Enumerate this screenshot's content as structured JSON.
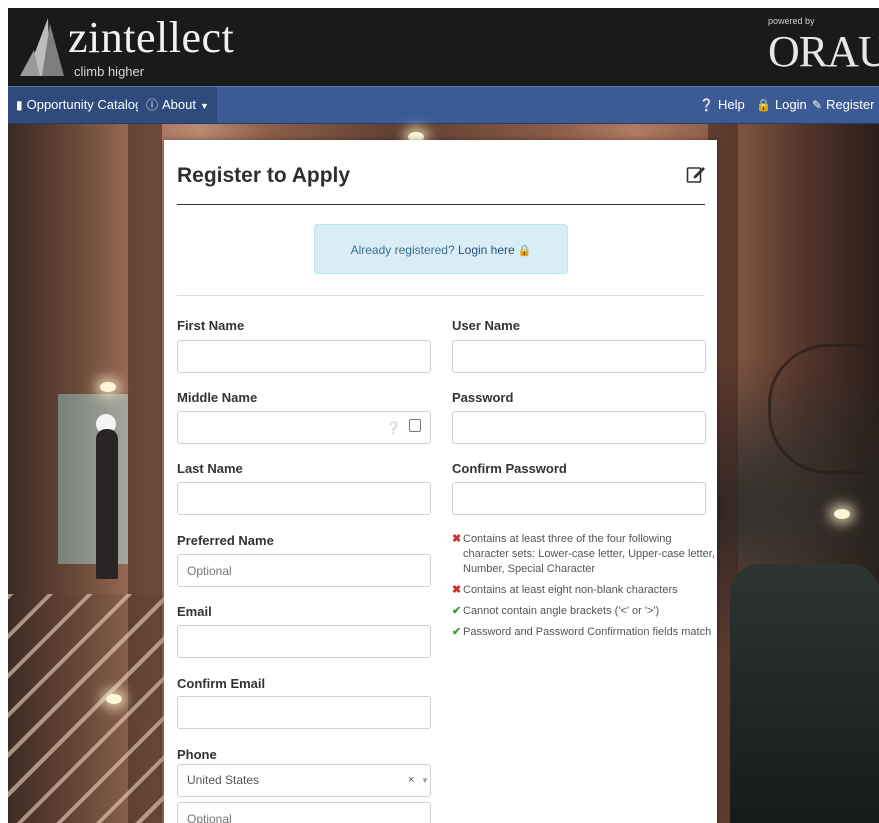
{
  "header": {
    "brand_name": "zintellect",
    "brand_tagline": "climb higher",
    "partner_prefix": "powered by",
    "partner_name": "ORAU"
  },
  "nav": {
    "catalog": {
      "label": "Opportunity Catalog",
      "icon": "book-icon"
    },
    "about": {
      "label": "About",
      "icon": "question-circle-icon"
    },
    "help": {
      "label": "Help",
      "icon": "info-circle-icon"
    },
    "login": {
      "label": "Login",
      "icon": "lock-icon"
    },
    "register": {
      "label": "Register",
      "icon": "edit-icon"
    }
  },
  "form": {
    "title": "Register to Apply",
    "login_prompt": "Already registered?",
    "login_link": "Login here",
    "fields": {
      "first_name": {
        "label": "First Name",
        "value": "",
        "placeholder": ""
      },
      "middle_name": {
        "label": "Middle Name",
        "value": "",
        "placeholder": ""
      },
      "last_name": {
        "label": "Last Name",
        "value": "",
        "placeholder": ""
      },
      "preferred_name": {
        "label": "Preferred Name",
        "value": "",
        "placeholder": "Optional"
      },
      "email": {
        "label": "Email",
        "value": "",
        "placeholder": ""
      },
      "confirm_email": {
        "label": "Confirm Email",
        "value": "",
        "placeholder": ""
      },
      "phone": {
        "label": "Phone",
        "country": "United States",
        "placeholder": "Optional"
      },
      "user_name": {
        "label": "User Name",
        "value": "",
        "placeholder": ""
      },
      "password": {
        "label": "Password",
        "value": "",
        "placeholder": ""
      },
      "confirm_password": {
        "label": "Confirm Password",
        "value": "",
        "placeholder": ""
      }
    },
    "password_rules": [
      {
        "text": "Contains at least three of the four following character sets: Lower-case letter, Upper-case letter, Number, Special Character",
        "status": "fail"
      },
      {
        "text": "Contains at least eight non-blank characters",
        "status": "fail"
      },
      {
        "text": "Cannot contain angle brackets ('<' or '>')",
        "status": "pass"
      },
      {
        "text": "Password and Password Confirmation fields match",
        "status": "pass"
      }
    ]
  },
  "colors": {
    "nav_bar": "#3c5b95",
    "header_bg": "#1a1a1a",
    "alert_bg": "#d9edf7",
    "fail": "#c9302c",
    "pass": "#3c9b3c"
  }
}
